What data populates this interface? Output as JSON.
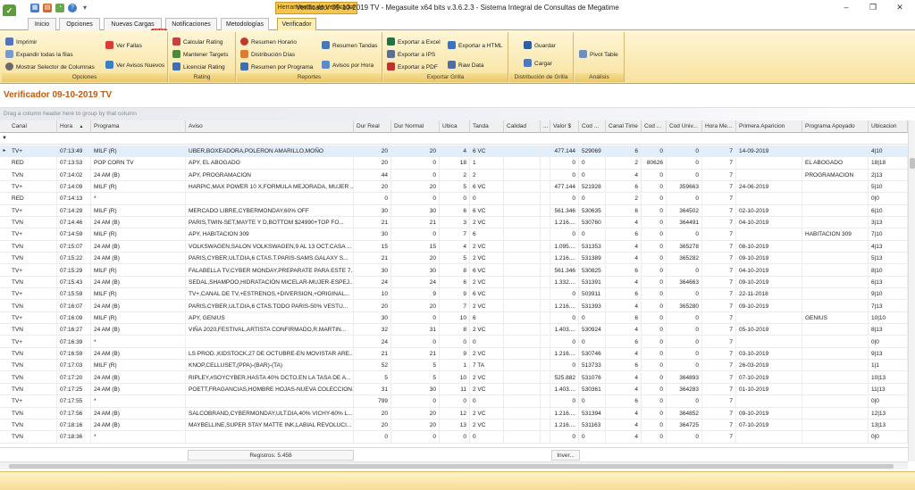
{
  "window": {
    "title": "Verificador 09-10-2019 TV - Megasuite x64 bits v.3.6.2.3 - Sistema Integral de Consultas de Megatime",
    "contextual_tab": "Herramientas de Verificador",
    "controls": [
      "–",
      "❐",
      "✕"
    ]
  },
  "tabs": [
    "Inicio",
    "Opciones",
    "Nuevas Cargas",
    "Notificaciones",
    "Metodologías",
    "Verificador"
  ],
  "badge": "1342",
  "ribbon": {
    "opciones": {
      "label": "Opciones",
      "items": [
        "Imprimir",
        "Expandir todas la filas",
        "Mostrar Selector de Columnas",
        "Ver Fallas",
        "Ver Avisos Nuevos"
      ]
    },
    "rating": {
      "label": "Rating",
      "items": [
        "Calcular Rating",
        "Mantener Targets",
        "Licenciar Rating"
      ]
    },
    "reportes": {
      "label": "Reportes",
      "items": [
        "Resumen Horario",
        "Distribución Días",
        "Resumen por Programa",
        "Resumen Tandas",
        "Avisos por Hora"
      ]
    },
    "exportar": {
      "label": "Exportar Grilla",
      "items": [
        "Exportar a Excel",
        "Exportar a IPS",
        "Exportar a PDF",
        "Exportar a HTML",
        "Raw Data"
      ]
    },
    "distribucion": {
      "label": "Distribución de Grilla",
      "items": [
        "Guardar",
        "Cargar"
      ]
    },
    "analisis": {
      "label": "Análisis",
      "items": [
        "Pivot Table"
      ]
    }
  },
  "view_title": "Verificador 09-10-2019 TV",
  "group_hint": "Drag a column header here to group by that column",
  "columns": [
    "Canal",
    "Hora",
    "Programa",
    "Aviso",
    "Dur Real",
    "Dur Normal",
    "Ubica",
    "Tanda",
    "Calidad",
    "...",
    "Valor $",
    "Cod ...",
    "Canal Time",
    "Cod ...",
    "Cod Univ...",
    "Hora Me...",
    "Primera Aparicion",
    "Programa Apoyado",
    "Ubicacion"
  ],
  "rows": [
    [
      "TV+",
      "07:13:49",
      "MILF (R)",
      "UBER,BOXEADORA,POLERON AMARILLO,MOÑO",
      "20",
      "20",
      "4",
      "6 VC",
      "",
      "",
      "477.144",
      "529069",
      "6",
      "0",
      "0",
      "7",
      "14-09-2019",
      "",
      "4|10"
    ],
    [
      "RED",
      "07:13:53",
      "POP CORN TV",
      "APY, EL ABOGADO",
      "20",
      "0",
      "18",
      "1",
      "",
      "",
      "0",
      "0",
      "2",
      "80626",
      "0",
      "7",
      "",
      "EL ABOGADO",
      "18|18"
    ],
    [
      "TVN",
      "07:14:02",
      "24 AM (B)",
      "APY, PROGRAMACION",
      "44",
      "0",
      "2",
      "2",
      "",
      "",
      "0",
      "0",
      "4",
      "0",
      "0",
      "7",
      "",
      "PROGRAMACION",
      "2|13"
    ],
    [
      "TV+",
      "07:14:09",
      "MILF (R)",
      "HARPIC,MAX POWER 10 X,FORMULA MEJORADA, MUJER ...",
      "20",
      "20",
      "5",
      "6 VC",
      "",
      "",
      "477.144",
      "521928",
      "6",
      "0",
      "359663",
      "7",
      "24-06-2019",
      "",
      "5|10"
    ],
    [
      "RED",
      "07:14:13",
      "*",
      "",
      "0",
      "0",
      "0",
      "0",
      "",
      "",
      "0",
      "0",
      "2",
      "0",
      "0",
      "7",
      "",
      "",
      "0|0"
    ],
    [
      "TV+",
      "07:14:29",
      "MILF (R)",
      "MERCADO LIBRE,CYBERMONDAY,60% OFF",
      "30",
      "30",
      "6",
      "6 VC",
      "",
      "",
      "561.346",
      "530635",
      "6",
      "0",
      "364502",
      "7",
      "02-10-2019",
      "",
      "6|10"
    ],
    [
      "TVN",
      "07:14:46",
      "24 AM (B)",
      "PARIS,TWIN-SET,MAYTE Y  D,BOTTOM $24990+TOP FO...",
      "21",
      "21",
      "3",
      "2 VC",
      "",
      "",
      "1.216....",
      "530760",
      "4",
      "0",
      "364491",
      "7",
      "04-10-2019",
      "",
      "3|13"
    ],
    [
      "TV+",
      "07:14:59",
      "MILF (R)",
      "APY, HABITACION 309",
      "30",
      "0",
      "7",
      "6",
      "",
      "",
      "0",
      "0",
      "6",
      "0",
      "0",
      "7",
      "",
      "HABITACION 309",
      "7|10"
    ],
    [
      "TVN",
      "07:15:07",
      "24 AM (B)",
      "VOLKSWAGEN,SALON VOLKSWAGEN,9 AL 13 OCT.CASA ...",
      "15",
      "15",
      "4",
      "2 VC",
      "",
      "",
      "1.095....",
      "531353",
      "4",
      "0",
      "365278",
      "7",
      "08-10-2019",
      "",
      "4|13"
    ],
    [
      "TVN",
      "07:15:22",
      "24 AM (B)",
      "PARIS,CYBER,ULT.DIA,6 CTAS.T.PARIS-SAMS.GALAXY S...",
      "21",
      "20",
      "5",
      "2 VC",
      "",
      "",
      "1.216....",
      "531389",
      "4",
      "0",
      "365282",
      "7",
      "09-10-2019",
      "",
      "5|13"
    ],
    [
      "TV+",
      "07:15:29",
      "MILF (R)",
      "FALABELLA TV,CYBER MONDAY,PREPARATE PARA ESTE 7...",
      "30",
      "30",
      "8",
      "6 VC",
      "",
      "",
      "561.346",
      "530825",
      "6",
      "0",
      "0",
      "7",
      "04-10-2019",
      "",
      "8|10"
    ],
    [
      "TVN",
      "07:15:43",
      "24 AM (B)",
      "SEDAL,SHAMPOO,HIDRATACIÓN MICELAR-MUJER-ESPEJ...",
      "24",
      "24",
      "6",
      "2 VC",
      "",
      "",
      "1.332....",
      "531391",
      "4",
      "0",
      "364663",
      "7",
      "09-10-2019",
      "",
      "6|13"
    ],
    [
      "TV+",
      "07:15:59",
      "MILF (R)",
      "TV+,CANAL DE TV,+ESTRENOS,+DIVERSION,+ORIGINAL...",
      "10",
      "9",
      "9",
      "6 VC",
      "",
      "",
      "0",
      "503911",
      "6",
      "0",
      "0",
      "7",
      "22-11-2018",
      "",
      "9|10"
    ],
    [
      "TVN",
      "07:16:07",
      "24 AM (B)",
      "PARIS,CYBER,ULT.DIA,6 CTAS.TODO PARIS-50% VESTU...",
      "20",
      "20",
      "7",
      "2 VC",
      "",
      "",
      "1.216....",
      "531393",
      "4",
      "0",
      "365280",
      "7",
      "09-10-2019",
      "",
      "7|13"
    ],
    [
      "TV+",
      "07:16:09",
      "MILF (R)",
      "APY, GENIUS",
      "30",
      "0",
      "10",
      "6",
      "",
      "",
      "0",
      "0",
      "6",
      "0",
      "0",
      "7",
      "",
      "GENIUS",
      "10|10"
    ],
    [
      "TVN",
      "07:16:27",
      "24 AM (B)",
      "VIÑA 2020,FESTIVAL,ARTISTA CONFIRMADO,R.MARTIN...",
      "32",
      "31",
      "8",
      "2 VC",
      "",
      "",
      "1.403....",
      "530924",
      "4",
      "0",
      "0",
      "7",
      "05-10-2019",
      "",
      "8|13"
    ],
    [
      "TV+",
      "07:16:39",
      "*",
      "",
      "24",
      "0",
      "0",
      "0",
      "",
      "",
      "0",
      "0",
      "6",
      "0",
      "0",
      "7",
      "",
      "",
      "0|0"
    ],
    [
      "TVN",
      "07:16:59",
      "24 AM (B)",
      "LS PROD.,KIDSTOCK,27 DE OCTUBRE-EN MOVISTAR ARE...",
      "21",
      "21",
      "9",
      "2 VC",
      "",
      "",
      "1.216....",
      "530746",
      "4",
      "0",
      "0",
      "7",
      "03-10-2019",
      "",
      "9|13"
    ],
    [
      "TVN",
      "07:17:03",
      "MILF (R)",
      "KNOP,CELLUSET,(PPA)-(BAR)-(TA)",
      "52",
      "5",
      "1",
      "7 TA",
      "",
      "",
      "0",
      "513733",
      "6",
      "0",
      "0",
      "7",
      "26-03-2019",
      "",
      "1|1"
    ],
    [
      "TVN",
      "07:17:20",
      "24 AM (B)",
      "RIPLEY,#SOYCYBER,HASTA 40% DCTO.EN LA TASA DE A...",
      "5",
      "5",
      "10",
      "2 VC",
      "",
      "",
      "525.882",
      "531076",
      "4",
      "0",
      "364893",
      "7",
      "07-10-2019",
      "",
      "10|13"
    ],
    [
      "TVN",
      "07:17:25",
      "24 AM (B)",
      "POETT,FRAGANCIAS,HOMBRE HOJAS-NUEVA COLECCION...",
      "31",
      "30",
      "11",
      "2 VC",
      "",
      "",
      "1.403....",
      "530361",
      "4",
      "0",
      "364283",
      "7",
      "01-10-2019",
      "",
      "11|13"
    ],
    [
      "TV+",
      "07:17:55",
      "*",
      "",
      "799",
      "0",
      "0",
      "0",
      "",
      "",
      "0",
      "0",
      "6",
      "0",
      "0",
      "7",
      "",
      "",
      "0|0"
    ],
    [
      "TVN",
      "07:17:56",
      "24 AM (B)",
      "SALCOBRAND,CYBERMONDAY,ULT.DIA,40% VICHY-60% L...",
      "20",
      "20",
      "12",
      "2 VC",
      "",
      "",
      "1.216....",
      "531394",
      "4",
      "0",
      "364852",
      "7",
      "09-10-2019",
      "",
      "12|13"
    ],
    [
      "TVN",
      "07:18:16",
      "24 AM (B)",
      "MAYBELLINE,SUPER STAY MATTE INK,LABIAL REVOLUCI...",
      "20",
      "20",
      "13",
      "2 VC",
      "",
      "",
      "1.216....",
      "531163",
      "4",
      "0",
      "364725",
      "7",
      "07-10-2019",
      "",
      "13|13"
    ],
    [
      "TVN",
      "07:18:36",
      "*",
      "",
      "0",
      "0",
      "0",
      "0",
      "",
      "",
      "0",
      "0",
      "4",
      "0",
      "0",
      "7",
      "",
      "",
      "0|0"
    ]
  ],
  "footer": {
    "registros": "Registros: 5.458",
    "inver": "Inver..."
  }
}
